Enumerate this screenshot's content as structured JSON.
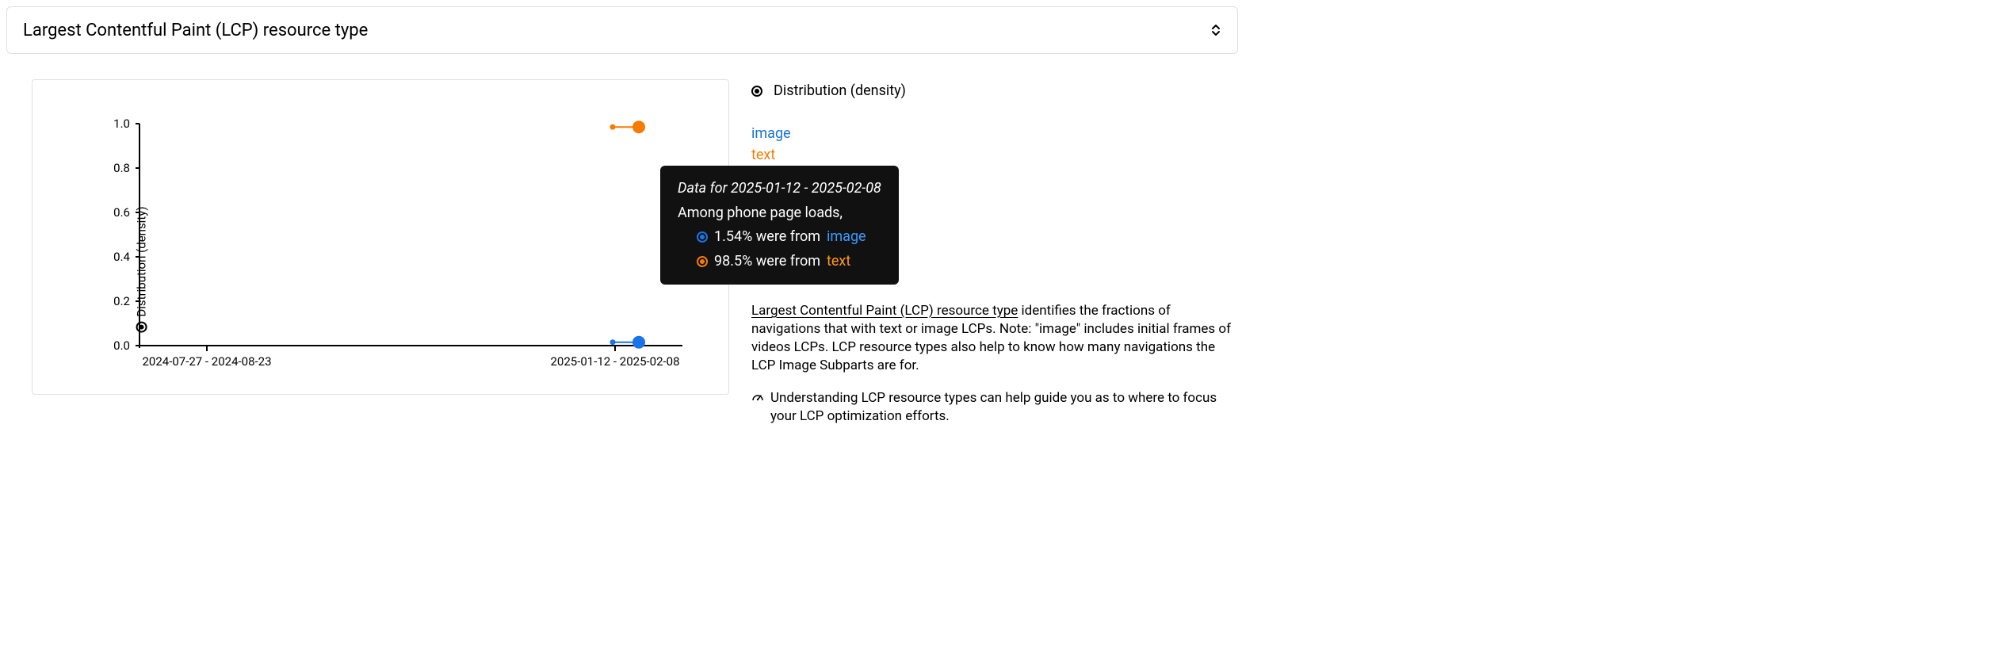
{
  "selector": {
    "label": "Largest Contentful Paint (LCP) resource type"
  },
  "legend": {
    "mode": "Distribution (density)",
    "series0": "image",
    "series1": "text"
  },
  "chart_data": {
    "type": "scatter",
    "ylabel": "Distribution (density)",
    "ylim": [
      0.0,
      1.0
    ],
    "yticks": [
      "0.0",
      "0.2",
      "0.4",
      "0.6",
      "0.8",
      "1.0"
    ],
    "x_categories": [
      "2024-07-27 - 2024-08-23",
      "2025-01-12 - 2025-02-08"
    ],
    "series": [
      {
        "name": "image",
        "color": "#1a73e8",
        "points": [
          {
            "x": "2025-01-12 - 2025-02-08",
            "y": 0.0154
          }
        ]
      },
      {
        "name": "text",
        "color": "#f57c00",
        "points": [
          {
            "x": "2025-01-12 - 2025-02-08",
            "y": 0.985
          }
        ]
      }
    ]
  },
  "tooltip": {
    "title": "Data for 2025-01-12 - 2025-02-08",
    "subtitle": "Among phone page loads,",
    "row_image_value": "1.54% were from ",
    "row_image_series": "image",
    "row_text_value": "98.5% were from ",
    "row_text_series": "text"
  },
  "description": {
    "link_text": "Largest Contentful Paint (LCP) resource type",
    "body": " identifies the fractions of navigations that with text or image LCPs. Note: \"image\" includes initial frames of videos LCPs. LCP resource types also help to know how many navigations the LCP Image Subparts are for."
  },
  "hint": {
    "text": "Understanding LCP resource types can help guide you as to where to focus your LCP optimization efforts."
  },
  "colors": {
    "image": "#1a73e8",
    "text": "#f57c00"
  }
}
